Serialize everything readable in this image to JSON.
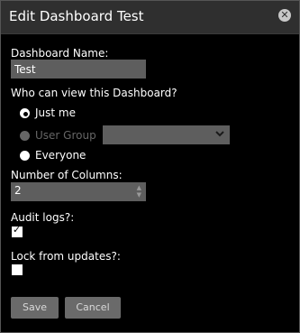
{
  "dialog": {
    "title": "Edit Dashboard Test",
    "close_glyph": "✕"
  },
  "form": {
    "name_label": "Dashboard Name:",
    "name_value": "Test",
    "view_label": "Who can view this Dashboard?",
    "options": {
      "just_me": "Just me",
      "user_group": "User Group",
      "everyone": "Everyone"
    },
    "selected_view": "just_me",
    "user_group_select_value": "",
    "columns_label": "Number of Columns:",
    "columns_value": "2",
    "audit_label": "Audit logs?:",
    "audit_checked": true,
    "lock_label": "Lock from updates?:",
    "lock_checked": false
  },
  "buttons": {
    "save": "Save",
    "cancel": "Cancel"
  },
  "colors": {
    "background": "#000000",
    "titlebar": "#2f2f2f",
    "input_bg": "#5e5e5e",
    "button_bg": "#6a6a6a"
  },
  "icons": {
    "close": "close-icon",
    "dropdown": "chevron-down-icon",
    "stepper": "stepper-icon",
    "checkmark": "checkmark-icon"
  }
}
